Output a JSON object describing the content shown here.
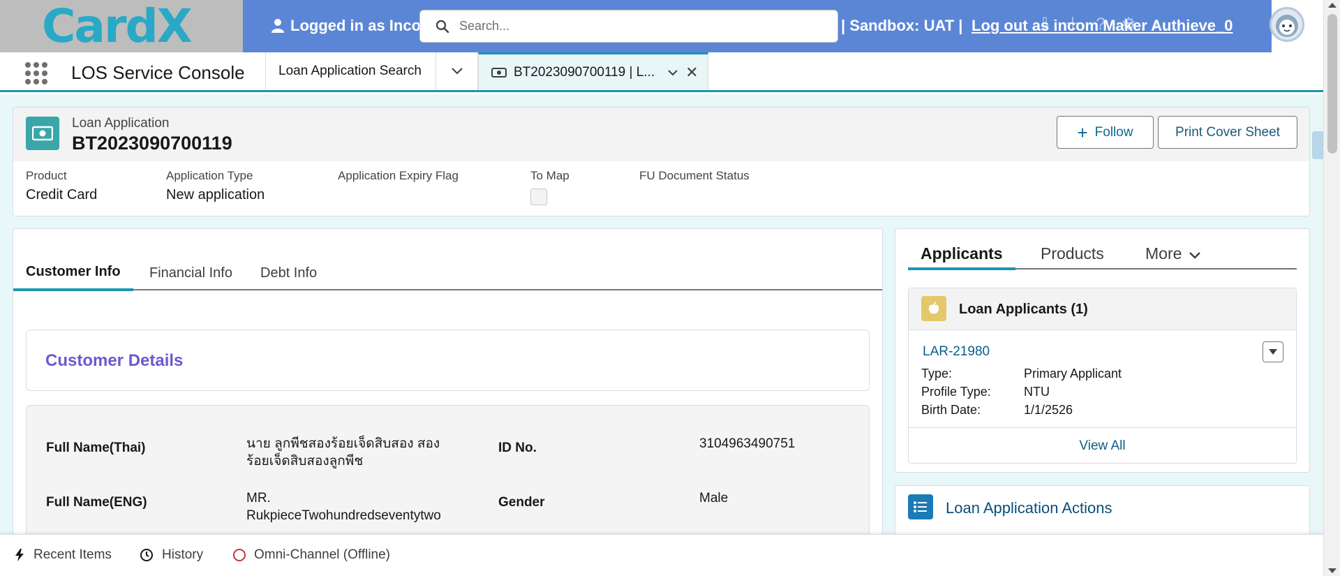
{
  "header": {
    "logo_text": "CardX",
    "logged_in_text": "Logged in as Inco",
    "search_placeholder": "Search...",
    "sandbox_text": "| Sandbox: UAT |",
    "logout_text": "Log out as incom Maker Authieve_0"
  },
  "nav": {
    "app_name": "LOS Service Console",
    "tabs": [
      {
        "label": "Loan Application Search"
      },
      {
        "label": "BT2023090700119 | L..."
      }
    ]
  },
  "record": {
    "object_label": "Loan Application",
    "title": "BT2023090700119",
    "follow_label": "Follow",
    "print_label": "Print Cover Sheet",
    "fields": [
      {
        "label": "Product",
        "value": "Credit Card"
      },
      {
        "label": "Application Type",
        "value": "New application"
      },
      {
        "label": "Application Expiry Flag",
        "value": ""
      },
      {
        "label": "To Map",
        "value": ""
      },
      {
        "label": "FU Document Status",
        "value": ""
      }
    ]
  },
  "main": {
    "tabs": [
      "Customer Info",
      "Financial Info",
      "Debt Info"
    ],
    "section_title": "Customer Details",
    "fields": [
      {
        "label": "Full Name(Thai)",
        "value": "นาย ลูกพีชสองร้อยเจ็ดสิบสอง สองร้อยเจ็ดสิบสองลูกพีช"
      },
      {
        "label": "ID No.",
        "value": "3104963490751"
      },
      {
        "label": "Full Name(ENG)",
        "value": "MR. RukpieceTwohundredseventytwo"
      },
      {
        "label": "Gender",
        "value": "Male"
      }
    ]
  },
  "applicants": {
    "tabs": [
      "Applicants",
      "Products",
      "More"
    ],
    "list_title": "Loan Applicants (1)",
    "record_link": "LAR-21980",
    "rows": [
      {
        "key": "Type:",
        "value": "Primary Applicant"
      },
      {
        "key": "Profile Type:",
        "value": "NTU"
      },
      {
        "key": "Birth Date:",
        "value": "1/1/2526"
      }
    ],
    "view_all": "View All"
  },
  "actions": {
    "title": "Loan Application Actions"
  },
  "utility": {
    "recent": "Recent Items",
    "history": "History",
    "omni": "Omni-Channel (Offline)"
  },
  "colors": {
    "banner": "#5b86d6",
    "accent": "#1b96b3",
    "section_title": "#6a5ad0",
    "record_icon": "#3aa6a9",
    "applicants_icon": "#e3c96a",
    "actions_icon": "#1b7ab8",
    "offline": "#c23934"
  }
}
